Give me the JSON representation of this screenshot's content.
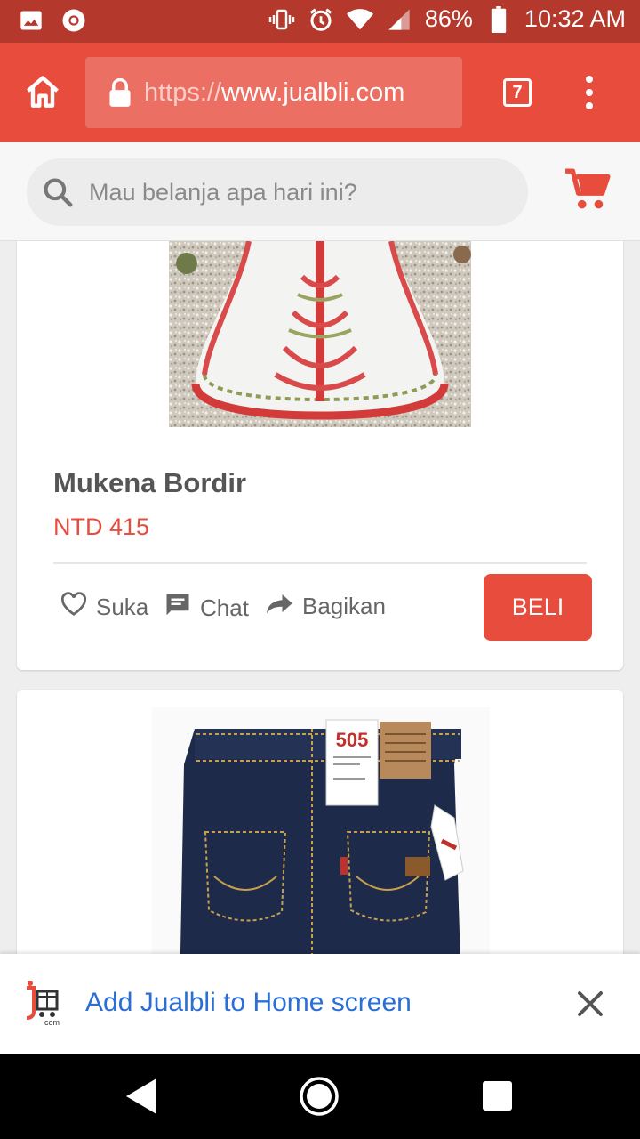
{
  "status_bar": {
    "battery": "86%",
    "time": "10:32 AM"
  },
  "browser": {
    "url_scheme": "https://",
    "url_host": "www.jualbli.com",
    "tab_count": "7"
  },
  "search": {
    "placeholder": "Mau belanja apa hari ini?"
  },
  "product": {
    "title": "Mukena Bordir",
    "price": "NTD 415",
    "actions": {
      "like": "Suka",
      "chat": "Chat",
      "share": "Bagikan"
    },
    "buy_label": "BELI"
  },
  "product2": {
    "tag_number": "505"
  },
  "install_banner": {
    "text": "Add Jualbli to Home screen",
    "logo_text": "com"
  },
  "colors": {
    "accent": "#e84c3d",
    "status_bar": "#b5382c",
    "link": "#2a6fd6"
  },
  "icons": [
    "image-icon",
    "chrome-icon",
    "vibrate-icon",
    "alarm-icon",
    "wifi-icon",
    "signal-icon",
    "battery-icon",
    "home-icon",
    "lock-icon",
    "more-vert-icon",
    "search-icon",
    "cart-icon",
    "heart-icon",
    "chat-icon",
    "share-icon",
    "close-icon",
    "back-icon",
    "home-circle-icon",
    "recents-icon"
  ]
}
